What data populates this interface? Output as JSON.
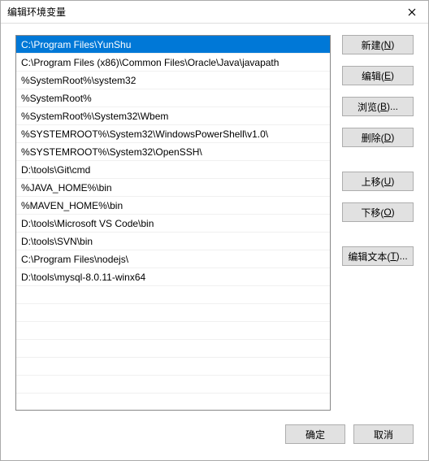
{
  "title": "编辑环境变量",
  "paths": [
    "C:\\Program Files\\YunShu",
    "C:\\Program Files (x86)\\Common Files\\Oracle\\Java\\javapath",
    "%SystemRoot%\\system32",
    "%SystemRoot%",
    "%SystemRoot%\\System32\\Wbem",
    "%SYSTEMROOT%\\System32\\WindowsPowerShell\\v1.0\\",
    "%SYSTEMROOT%\\System32\\OpenSSH\\",
    "D:\\tools\\Git\\cmd",
    "%JAVA_HOME%\\bin",
    "%MAVEN_HOME%\\bin",
    "D:\\tools\\Microsoft VS Code\\bin",
    "D:\\tools\\SVN\\bin",
    "C:\\Program Files\\nodejs\\",
    "D:\\tools\\mysql-8.0.11-winx64"
  ],
  "selected_index": 0,
  "buttons": {
    "new": {
      "text": "新建(",
      "mnemonic": "N",
      "suffix": ")"
    },
    "edit": {
      "text": "编辑(",
      "mnemonic": "E",
      "suffix": ")"
    },
    "browse": {
      "text": "浏览(",
      "mnemonic": "B",
      "suffix": ")..."
    },
    "delete": {
      "text": "删除(",
      "mnemonic": "D",
      "suffix": ")"
    },
    "moveup": {
      "text": "上移(",
      "mnemonic": "U",
      "suffix": ")"
    },
    "movedown": {
      "text": "下移(",
      "mnemonic": "O",
      "suffix": ")"
    },
    "edittext": {
      "text": "编辑文本(",
      "mnemonic": "T",
      "suffix": ")..."
    }
  },
  "footer": {
    "ok": "确定",
    "cancel": "取消"
  }
}
